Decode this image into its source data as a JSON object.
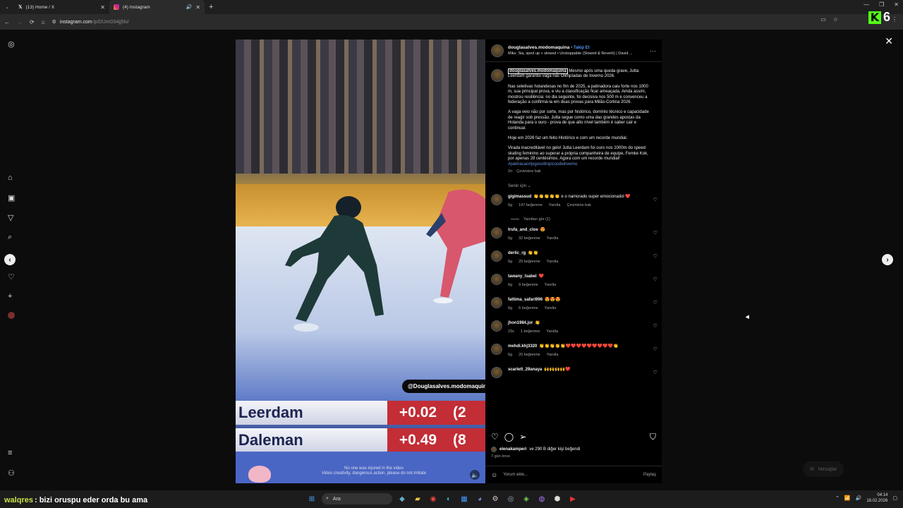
{
  "browser": {
    "tabs": [
      {
        "title": "(13) Home / X",
        "icon": "x-logo-icon",
        "active": false
      },
      {
        "title": "(4) Instagram",
        "icon": "instagram-logo-icon",
        "active": true
      }
    ],
    "url_host": "instagram.com",
    "url_path": "/p/DUmG94jj5ki/",
    "badge_number": "6"
  },
  "video": {
    "watermark": "@Douglasalves.modomaquina",
    "scoreboard": [
      {
        "name": "Leerdam",
        "diff": "+0.02",
        "rank": "(2"
      },
      {
        "name": "Daleman",
        "diff": "+0.49",
        "rank": "(8"
      }
    ],
    "disclaimer_1": "No one was injured in the video",
    "disclaimer_2": "Video creativity, dangerous action, please do not imitate"
  },
  "post": {
    "author": "douglasalves.modomaquina",
    "separator": "•",
    "follow_label": "Takip Et",
    "audio": "Miks: Sia, sped up + slowed • Unstoppable (Slowed & Reverb) | David ...",
    "caption_mention": "douglasalves.modomaquina",
    "caption_p1": "Mesmo após uma queda grave, Jutta Leerdam garantiu vaga nas Olimpíadas de Inverno 2026.",
    "caption_p2": "Nas seletivas holandesas no fim de 2025, a patinadora caiu forte nos 1000 m, sua principal prova, e viu a classificação ficar ameaçada. Ainda assim, mostrou resiliência: no dia seguinte, foi decisiva nos 500 m e convenceu a federação a confirmá-la em duas provas para Milão-Cortina 2026.",
    "caption_p3": "A vaga veio não por sorte, mas por histórico, domínio técnico e capacidade de reagir sob pressão. Jutta segue como uma das grandes apostas da Holanda para o ouro - prova de que alto nível também é saber cair e continuar.",
    "caption_p4": "Hoje em 2026 faz um feito Histórico e com um recorde mundial.",
    "caption_p5": "Virada inacreditável no gelo! Jutta Leerdam foi ouro nos 1000m do speed skating feminino ao superar a própria companheira de equipe, Femke Kok, por apenas 28 centésimos. Agora com um recorde mundial!",
    "caption_tags": "#patinacao#jogosolimpicosdeinverno",
    "caption_time": "1h",
    "translate_label": "Çevirisine bak",
    "sort_label": "Senin için"
  },
  "comments": [
    {
      "user": "gigimassud",
      "text": "👏👏👏👏👏 e o namorado super emocionadol ❤️",
      "time": "6g",
      "likes": "147 beğenme",
      "reply": "Yanıtla",
      "translate": "Çevirisine bak"
    },
    {
      "user": "trufa_and_cloe",
      "text": "😍",
      "time": "6g",
      "likes": "32 beğenme",
      "reply": "Yanıtla"
    },
    {
      "user": "derlic_rg",
      "text": "👏👏",
      "time": "6g",
      "likes": "29 beğenme",
      "reply": "Yanıtla"
    },
    {
      "user": "tawany_lsabel",
      "text": "❤️",
      "time": "6g",
      "likes": "9 beğenme",
      "reply": "Yanıtla"
    },
    {
      "user": "fattima_safari996",
      "text": "😍😍😍",
      "time": "6g",
      "likes": "6 beğenme",
      "reply": "Yanıtla"
    },
    {
      "user": "jhon1984.jor",
      "text": "👏",
      "time": "23s",
      "likes": "1 beğenme",
      "reply": "Yanıtla"
    },
    {
      "user": "mehdi.khj3320",
      "text": "👏👏👏👏👏❤️❤️❤️❤️❤️❤️❤️❤️❤️👏",
      "time": "6g",
      "likes": "20 beğenme",
      "reply": "Yanıtla"
    },
    {
      "user": "scarlett_29anaya",
      "text": "🙌🙌🙌🙌❤️",
      "time": "",
      "likes": "",
      "reply": ""
    }
  ],
  "view_replies": "Yanıtları gör (1)",
  "likes_line": {
    "user": "elenakamperi",
    "rest": "ve 290 B diğer kişi beğendi"
  },
  "post_date": "7 gün önce",
  "add_comment": {
    "placeholder": "Yorum ekle...",
    "post_label": "Paylaş"
  },
  "messages_label": "Mesajlar",
  "chat": {
    "user": "walqres",
    "text": ": bizi oruspu eder orda bu ama"
  },
  "taskbar": {
    "search_label": "Ara",
    "time": "04:14",
    "date": "18.02.2026"
  }
}
